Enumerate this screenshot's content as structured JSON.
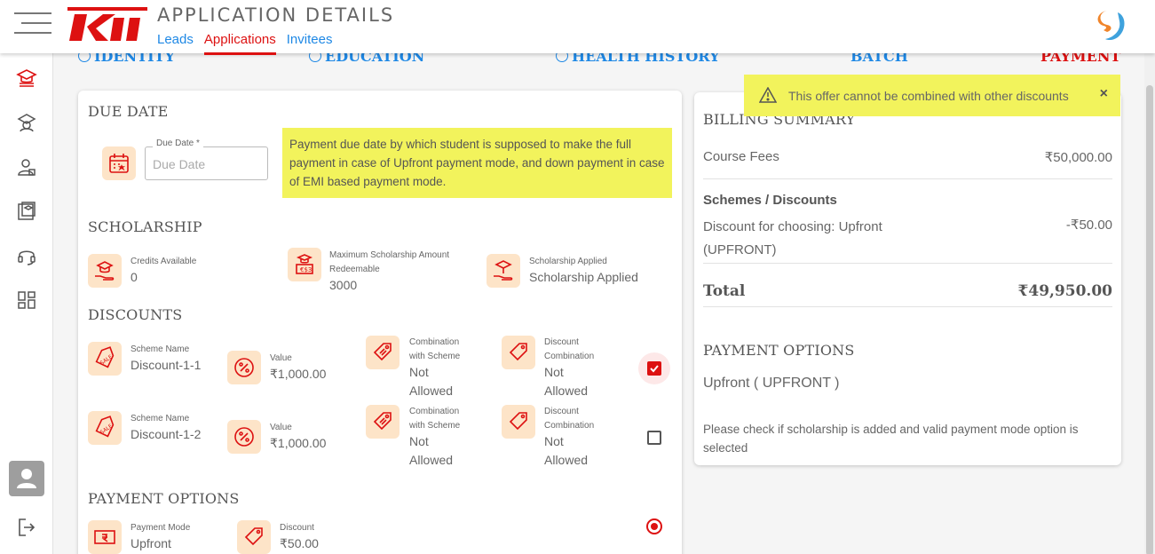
{
  "header": {
    "title": "APPLICATION DETAILS",
    "tabs": [
      {
        "label": "Leads",
        "active": false
      },
      {
        "label": "Applications",
        "active": true
      },
      {
        "label": "Invitees",
        "active": false
      }
    ],
    "logo_text": "Kii"
  },
  "sidebar": {
    "items": [
      "graduation-icon",
      "school-icon",
      "student-icon",
      "courses-icon",
      "headset-icon",
      "grid-icon"
    ],
    "logout_icon": "logout-icon"
  },
  "steps": [
    {
      "label": "IDENTITY",
      "done": true
    },
    {
      "label": "EDUCATION",
      "done": true
    },
    {
      "label": "HEALTH HISTORY",
      "done": true
    },
    {
      "label": "BATCH",
      "done": false
    },
    {
      "label": "PAYMENT",
      "active": true
    }
  ],
  "due_date": {
    "title": "DUE DATE",
    "field_label": "Due Date *",
    "placeholder": "Due Date",
    "note": "Payment due date by which student is supposed to make the full payment in case of Upfront payment mode, and down payment in case of EMI based payment mode."
  },
  "scholarship": {
    "title": "SCHOLARSHIP",
    "credits_label": "Credits Available",
    "credits_value": "0",
    "max_label": "Maximum Scholarship Amount Redeemable",
    "max_value": "3000",
    "applied_label": "Scholarship Applied",
    "applied_value": "Scholarship Applied"
  },
  "discounts": {
    "title": "DISCOUNTS",
    "rows": [
      {
        "scheme_label": "Scheme Name",
        "scheme": "Discount-1-1",
        "value_label": "Value",
        "value": "₹1,000.00",
        "comb_scheme_label": "Combination with Scheme",
        "comb_scheme": "Not Allowed",
        "comb_disc_label": "Discount Combination",
        "comb_disc": "Not Allowed",
        "checked": true
      },
      {
        "scheme_label": "Scheme Name",
        "scheme": "Discount-1-2",
        "value_label": "Value",
        "value": "₹1,000.00",
        "comb_scheme_label": "Combination with Scheme",
        "comb_scheme": "Not Allowed",
        "comb_disc_label": "Discount Combination",
        "comb_disc": "Not Allowed",
        "checked": false
      }
    ]
  },
  "payment_options": {
    "title": "PAYMENT OPTIONS",
    "mode_label": "Payment Mode",
    "mode_value": "Upfront",
    "discount_label": "Discount",
    "discount_value": "₹50.00"
  },
  "billing": {
    "title": "BILLING SUMMARY",
    "course_fees_label": "Course Fees",
    "course_fees": "₹50,000.00",
    "schemes_title": "Schemes / Discounts",
    "discount_label": "Discount for choosing: Upfront (UPFRONT)",
    "discount_value": "-₹50.00",
    "total_label": "Total",
    "total_value": "₹49,950.00",
    "payment_options_title": "PAYMENT OPTIONS",
    "payment_option": "Upfront ( UPFRONT )",
    "footnote": "Please check if scholarship is added and valid payment mode option is selected"
  },
  "toast": {
    "message": "This offer cannot be combined with other discounts",
    "close": "×"
  },
  "colors": {
    "accent": "#dd1111",
    "link": "#1e88e5",
    "highlight": "#f2f35c",
    "icon_bg": "#fde4c8"
  }
}
